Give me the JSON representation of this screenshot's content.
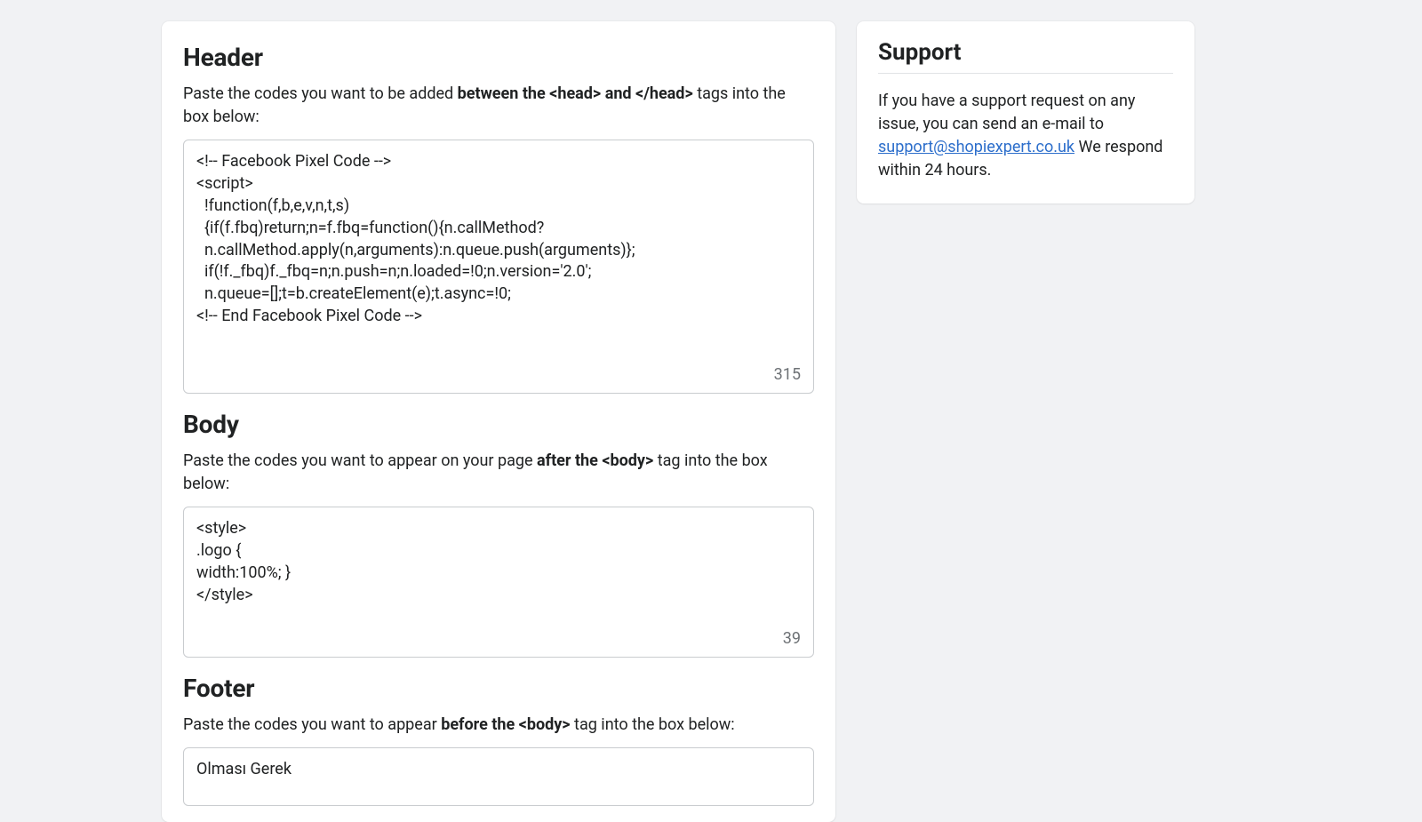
{
  "sections": {
    "header": {
      "title": "Header",
      "desc_pre": "Paste the codes you want to be added ",
      "desc_bold": "between the <head> and </head>",
      "desc_post": " tags into the box below:",
      "code": "<!-- Facebook Pixel Code -->\n<script>\n  !function(f,b,e,v,n,t,s)\n  {if(f.fbq)return;n=f.fbq=function(){n.callMethod?\n  n.callMethod.apply(n,arguments):n.queue.push(arguments)};\n  if(!f._fbq)f._fbq=n;n.push=n;n.loaded=!0;n.version='2.0';\n  n.queue=[];t=b.createElement(e);t.async=!0;\n<!-- End Facebook Pixel Code -->",
      "char_count": "315"
    },
    "body": {
      "title": "Body",
      "desc_pre": "Paste the codes you want to appear on your page ",
      "desc_bold": "after the <body>",
      "desc_post": " tag into the box below:",
      "code": "<style>\n.logo {\nwidth:100%; }\n</style>",
      "char_count": "39"
    },
    "footer": {
      "title": "Footer",
      "desc_pre": "Paste the codes you want to appear ",
      "desc_bold": "before the <body>",
      "desc_post": " tag into the box below:",
      "code": "Olması Gerek"
    }
  },
  "support": {
    "title": "Support",
    "text_pre": "If you have a support request on any issue, you can send an e-mail to ",
    "email": "support@shopiexpert.co.uk",
    "text_post": " We respond within 24 hours."
  }
}
